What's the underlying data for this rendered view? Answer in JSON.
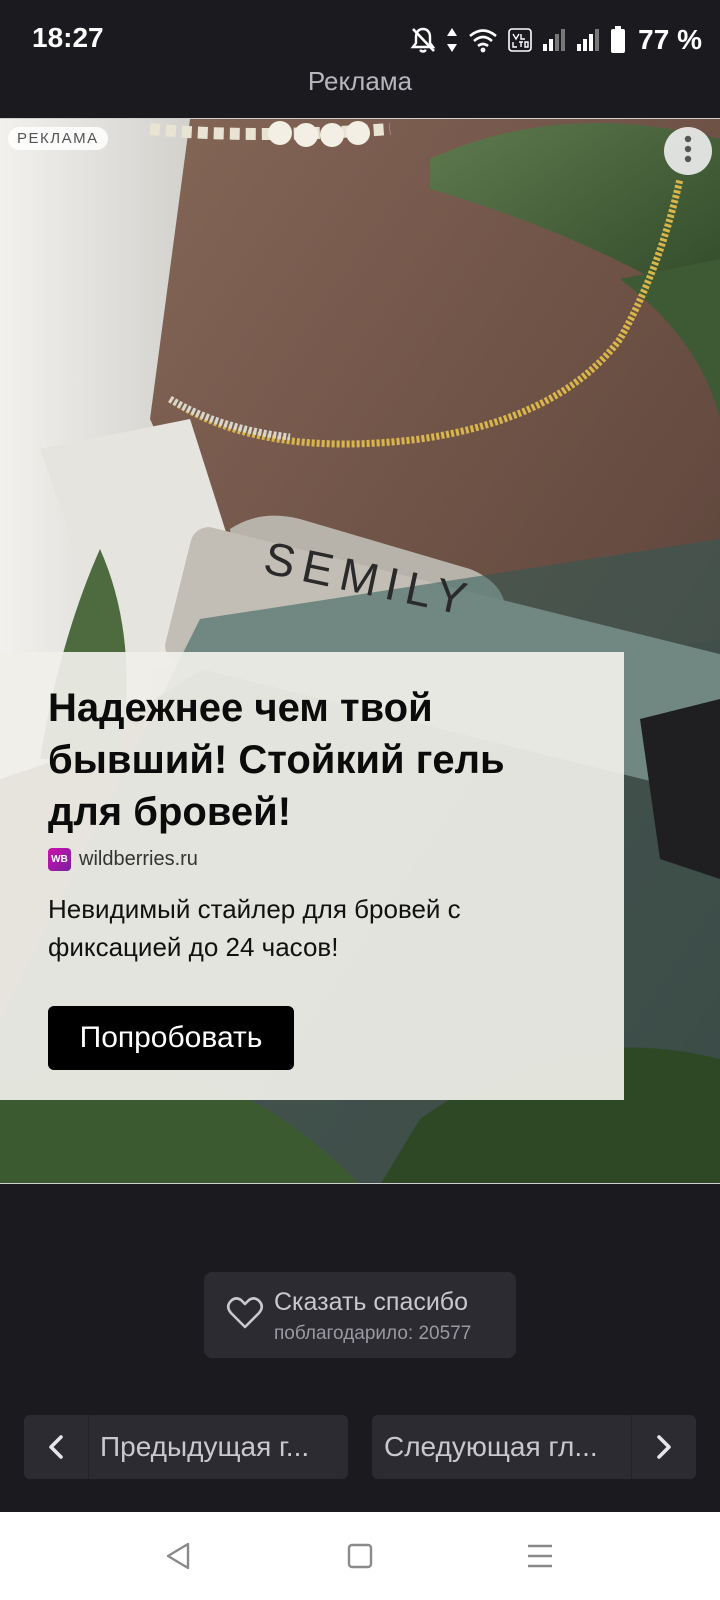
{
  "status_bar": {
    "time": "18:27",
    "battery_percent": "77 %",
    "network_badge": "VoLTE",
    "icons": [
      "notifications-off-icon",
      "data-arrows-icon",
      "wifi-icon",
      "volte-icon",
      "signal-1-icon",
      "signal-2-icon",
      "battery-icon"
    ]
  },
  "header": {
    "title": "Реклама"
  },
  "ad": {
    "label": "РЕКЛАМА",
    "photo_text": "SEMILY",
    "headline": "Надежнее чем твой бывший! Стойкий гель для бровей!",
    "source_logo_text": "WB",
    "source_domain": "wildberries.ru",
    "description": "Невидимый стайлер для бровей с фиксацией до 24 часов!",
    "cta_label": "Попробовать",
    "menu_icon": "more-vertical-icon"
  },
  "thanks": {
    "label": "Сказать спасибо",
    "count_text": "поблагодарило: 20577",
    "icon": "heart-icon"
  },
  "chapter_nav": {
    "prev_label": "Предыдущая г...",
    "next_label": "Следующая гл..."
  },
  "system_nav": {
    "icons": [
      "back-icon",
      "home-icon",
      "menu-icon"
    ]
  }
}
